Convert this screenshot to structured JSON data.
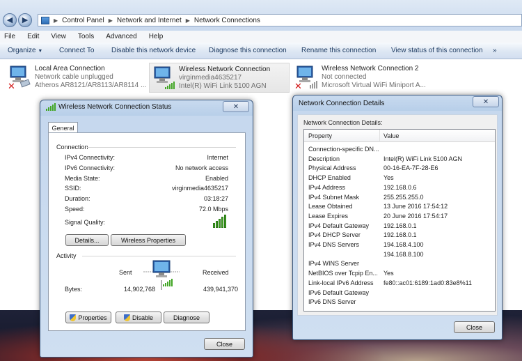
{
  "explorer": {
    "breadcrumb": [
      "Control Panel",
      "Network and Internet",
      "Network Connections"
    ],
    "menu": [
      "File",
      "Edit",
      "View",
      "Tools",
      "Advanced",
      "Help"
    ],
    "commands": {
      "organize": "Organize",
      "connect_to": "Connect To",
      "disable": "Disable this network device",
      "diagnose": "Diagnose this connection",
      "rename": "Rename this connection",
      "view_status": "View status of this connection",
      "more": "»"
    },
    "connections": [
      {
        "name": "Local Area Connection",
        "status": "Network cable unplugged",
        "device": "Atheros AR8121/AR8113/AR8114 ..."
      },
      {
        "name": "Wireless Network Connection",
        "status": "virginmedia4635217",
        "device": "Intel(R) WiFi Link 5100 AGN"
      },
      {
        "name": "Wireless Network Connection 2",
        "status": "Not connected",
        "device": "Microsoft Virtual WiFi Miniport A..."
      }
    ]
  },
  "status_dialog": {
    "title": "Wireless Network Connection Status",
    "close_x": "✕",
    "tab": "General",
    "connection_heading": "Connection",
    "rows": [
      {
        "label": "IPv4 Connectivity:",
        "value": "Internet"
      },
      {
        "label": "IPv6 Connectivity:",
        "value": "No network access"
      },
      {
        "label": "Media State:",
        "value": "Enabled"
      },
      {
        "label": "SSID:",
        "value": "virginmedia4635217"
      },
      {
        "label": "Duration:",
        "value": "03:18:27"
      },
      {
        "label": "Speed:",
        "value": "72.0 Mbps"
      }
    ],
    "signal_label": "Signal Quality:",
    "signal_level": 5,
    "signal_max": 5,
    "details_btn": "Details...",
    "wireless_btn": "Wireless Properties",
    "activity_heading": "Activity",
    "sent_label": "Sent",
    "received_label": "Received",
    "bytes_label": "Bytes:",
    "bytes_sent": "14,902,768",
    "bytes_received": "439,941,370",
    "properties_btn": "Properties",
    "disable_btn": "Disable",
    "diagnose_btn": "Diagnose",
    "close_btn": "Close"
  },
  "details_dialog": {
    "title": "Network Connection Details",
    "close_x": "✕",
    "caption": "Network Connection Details:",
    "col_property": "Property",
    "col_value": "Value",
    "rows": [
      {
        "p": "Connection-specific DN...",
        "v": ""
      },
      {
        "p": "Description",
        "v": "Intel(R) WiFi Link 5100 AGN"
      },
      {
        "p": "Physical Address",
        "v": "00-16-EA-7F-28-E6"
      },
      {
        "p": "DHCP Enabled",
        "v": "Yes"
      },
      {
        "p": "IPv4 Address",
        "v": "192.168.0.6"
      },
      {
        "p": "IPv4 Subnet Mask",
        "v": "255.255.255.0"
      },
      {
        "p": "Lease Obtained",
        "v": "13 June 2016 17:54:12"
      },
      {
        "p": "Lease Expires",
        "v": "20 June 2016 17:54:17"
      },
      {
        "p": "IPv4 Default Gateway",
        "v": "192.168.0.1"
      },
      {
        "p": "IPv4 DHCP Server",
        "v": "192.168.0.1"
      },
      {
        "p": "IPv4 DNS Servers",
        "v": "194.168.4.100"
      },
      {
        "p": "",
        "v": "194.168.8.100"
      },
      {
        "p": "IPv4 WINS Server",
        "v": ""
      },
      {
        "p": "NetBIOS over Tcpip En...",
        "v": "Yes"
      },
      {
        "p": "Link-local IPv6 Address",
        "v": "fe80::ac01:6189:1ad0:83e8%11"
      },
      {
        "p": "IPv6 Default Gateway",
        "v": ""
      },
      {
        "p": "IPv6 DNS Server",
        "v": ""
      }
    ],
    "close_btn": "Close"
  },
  "colors": {
    "signal": "#43a626",
    "error_x": "#d21a1a",
    "title_bar": "#b8cfe9"
  }
}
